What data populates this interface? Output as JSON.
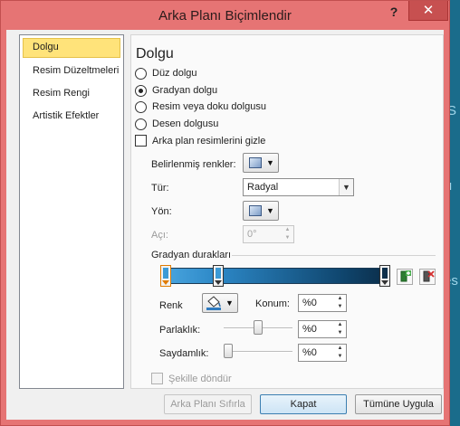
{
  "dialog": {
    "title": "Arka Planı Biçimlendir",
    "help": "?",
    "close": "✕"
  },
  "nav": {
    "items": [
      "Dolgu",
      "Resim Düzeltmeleri",
      "Resim Rengi",
      "Artistik Efektler"
    ]
  },
  "panel": {
    "title": "Dolgu",
    "fill_options": [
      "Düz dolgu",
      "Gradyan dolgu",
      "Resim veya doku dolgusu",
      "Desen dolgusu"
    ],
    "selected_fill": "Gradyan dolgu",
    "hide_bg": "Arka plan resimlerini gizle",
    "preset_label": "Belirlenmiş renkler:",
    "type_label": "Tür:",
    "type_value": "Radyal",
    "direction_label": "Yön:",
    "angle_label": "Açı:",
    "angle_value": "0°",
    "stops_label": "Gradyan durakları",
    "color_label": "Renk",
    "position_label": "Konum:",
    "position_value": "%0",
    "brightness_label": "Parlaklık:",
    "brightness_value": "%0",
    "transparency_label": "Saydamlık:",
    "transparency_value": "%0",
    "rotate_label": "Şekille döndür"
  },
  "gradient": {
    "stops": [
      {
        "position": 0,
        "color": "#3c9ad6",
        "selected": true
      },
      {
        "position": 0.24,
        "color": "#3c9ad6",
        "selected": false
      },
      {
        "position": 1,
        "color": "#0d2f4b",
        "selected": false
      }
    ],
    "colors": [
      "#4ba7e0",
      "#2c87c6",
      "#0f456d",
      "#0b2c47"
    ]
  },
  "sliders": {
    "brightness": 0.5,
    "transparency": 0
  },
  "footer": {
    "reset": "Arka Planı Sıfırla",
    "close": "Kapat",
    "apply_all": "Tümüne Uygula"
  },
  "background": {
    "fragments": [
      "S",
      "lı",
      "es"
    ]
  },
  "colors": {
    "accent": "#ffe37a",
    "titlebar": "#e67474",
    "close": "#c75050"
  }
}
